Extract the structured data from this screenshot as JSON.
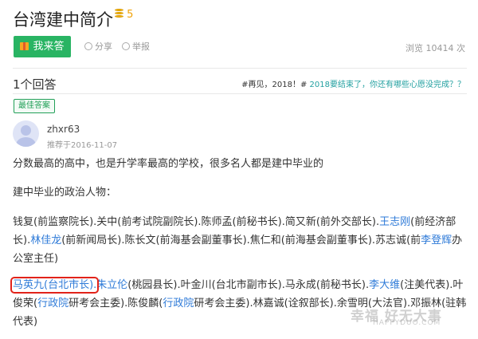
{
  "question": {
    "title": "台湾建中简介",
    "reward": "5",
    "answer_button": "我来答",
    "share_label": "分享",
    "report_label": "举报",
    "views": "浏览 10414 次"
  },
  "answers_header": {
    "count_label": "1个回答",
    "promo_prefix": "#再见，2018！#",
    "promo_link": "2018要结束了，你还有哪些心愿没完成？？"
  },
  "answer": {
    "best_badge": "最佳答案",
    "username": "zhxr63",
    "recommended": "推荐于2016-11-07",
    "p1": "分数最高的高中，也是升学率最高的学校，很多名人都是建中毕业的",
    "p2": "建中毕业的政治人物：",
    "p3": {
      "a": "钱复(前监察院长).关中(前考试院副院长).陈师孟(前秘书长).简又新(前外交部长).",
      "l1": "王志刚",
      "b": "(前经济部长).",
      "l2": "林佳龙",
      "c": "(前新闻局长).陈长文(前海基会副董事长).焦仁和(前海基会副董事长).苏志诚(前",
      "l3": "李登辉",
      "d": "办公室主任)"
    },
    "p4": {
      "hl": "马英九(台北市长).",
      "l1": "朱立伦",
      "a": "(桃园县长).叶金川(台北市副市长).马永成(前秘书长).",
      "l2": "李大维",
      "b": "(注美代表).叶俊荣(",
      "l3": "行政院",
      "c": "研考会主委).陈俊麟(",
      "l4": "行政院",
      "d": "研考会主委).林嘉诚(诠叙部长).余雪明(大法官).邓振林(驻韩代表)"
    }
  },
  "watermark": {
    "main": "幸福 好无大事",
    "sub": "HAPPYDUO.COM"
  }
}
